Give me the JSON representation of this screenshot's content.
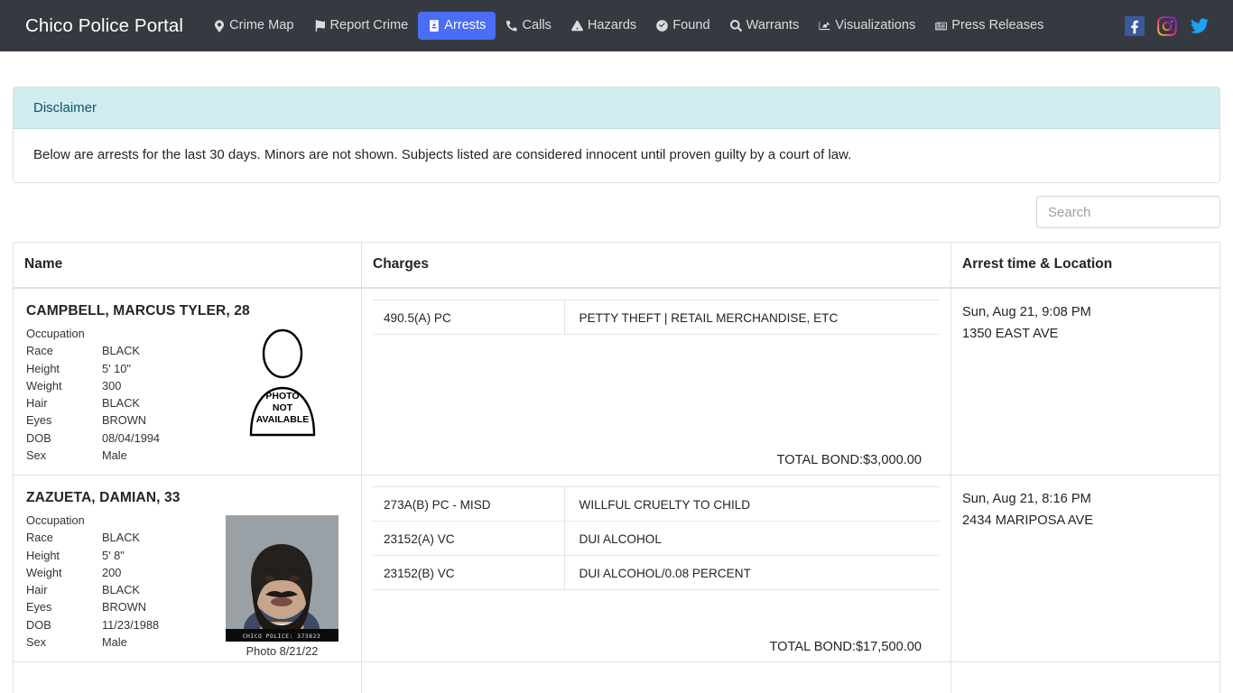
{
  "navbar": {
    "brand": "Chico Police Portal",
    "items": [
      {
        "label": "Crime Map",
        "icon": "map-pin-icon",
        "active": false
      },
      {
        "label": "Report Crime",
        "icon": "flag-icon",
        "active": false
      },
      {
        "label": "Arrests",
        "icon": "id-badge-icon",
        "active": true
      },
      {
        "label": "Calls",
        "icon": "phone-icon",
        "active": false
      },
      {
        "label": "Hazards",
        "icon": "warning-triangle-icon",
        "active": false
      },
      {
        "label": "Found",
        "icon": "check-circle-icon",
        "active": false
      },
      {
        "label": "Warrants",
        "icon": "search-icon",
        "active": false
      },
      {
        "label": "Visualizations",
        "icon": "chart-icon",
        "active": false
      },
      {
        "label": "Press Releases",
        "icon": "newspaper-icon",
        "active": false
      }
    ],
    "social": [
      {
        "name": "facebook-icon",
        "color": "#3b5998"
      },
      {
        "name": "instagram-icon",
        "color": "#e1306c"
      },
      {
        "name": "twitter-icon",
        "color": "#1da1f2"
      }
    ]
  },
  "disclaimer": {
    "title": "Disclaimer",
    "body": "Below are arrests for the last 30 days. Minors are not shown. Subjects listed are considered innocent until proven guilty by a court of law."
  },
  "search": {
    "placeholder": "Search",
    "value": ""
  },
  "table": {
    "headers": {
      "name": "Name",
      "charges": "Charges",
      "arrest": "Arrest time & Location"
    },
    "attr_labels": {
      "occupation": "Occupation",
      "race": "Race",
      "height": "Height",
      "weight": "Weight",
      "hair": "Hair",
      "eyes": "Eyes",
      "dob": "DOB",
      "sex": "Sex"
    },
    "rows": [
      {
        "name": "CAMPBELL, MARCUS TYLER, 28",
        "occupation": "",
        "race": "BLACK",
        "height": "5' 10\"",
        "weight": "300",
        "hair": "BLACK",
        "eyes": "BROWN",
        "dob": "08/04/1994",
        "sex": "Male",
        "photo": {
          "available": false,
          "placeholder_lines": [
            "PHOTO",
            "NOT",
            "AVAILABLE"
          ],
          "caption": ""
        },
        "charges": [
          {
            "code": "490.5(A) PC",
            "description": "PETTY THEFT | RETAIL MERCHANDISE, ETC"
          }
        ],
        "total_bond": "TOTAL BOND:$3,000.00",
        "arrest_time": "Sun, Aug 21, 9:08 PM",
        "arrest_location": "1350 EAST AVE"
      },
      {
        "name": "ZAZUETA, DAMIAN, 33",
        "occupation": "",
        "race": "BLACK",
        "height": "5' 8\"",
        "weight": "200",
        "hair": "BLACK",
        "eyes": "BROWN",
        "dob": "11/23/1988",
        "sex": "Male",
        "photo": {
          "available": true,
          "booking_stamp": "CHICO POLICE: 373823",
          "caption": "Photo 8/21/22"
        },
        "charges": [
          {
            "code": "273A(B) PC - MISD",
            "description": "WILLFUL CRUELTY TO CHILD"
          },
          {
            "code": "23152(A) VC",
            "description": "DUI ALCOHOL"
          },
          {
            "code": "23152(B) VC",
            "description": "DUI ALCOHOL/0.08 PERCENT"
          }
        ],
        "total_bond": "TOTAL BOND:$17,500.00",
        "arrest_time": "Sun, Aug 21, 8:16 PM",
        "arrest_location": "2434 MARIPOSA AVE"
      }
    ]
  },
  "colors": {
    "navbar_bg": "#343a40",
    "active_tab": "#4a6cf7",
    "disclaimer_bg": "#d1ecf1",
    "disclaimer_text": "#0c5460",
    "border": "#dee2e6"
  }
}
